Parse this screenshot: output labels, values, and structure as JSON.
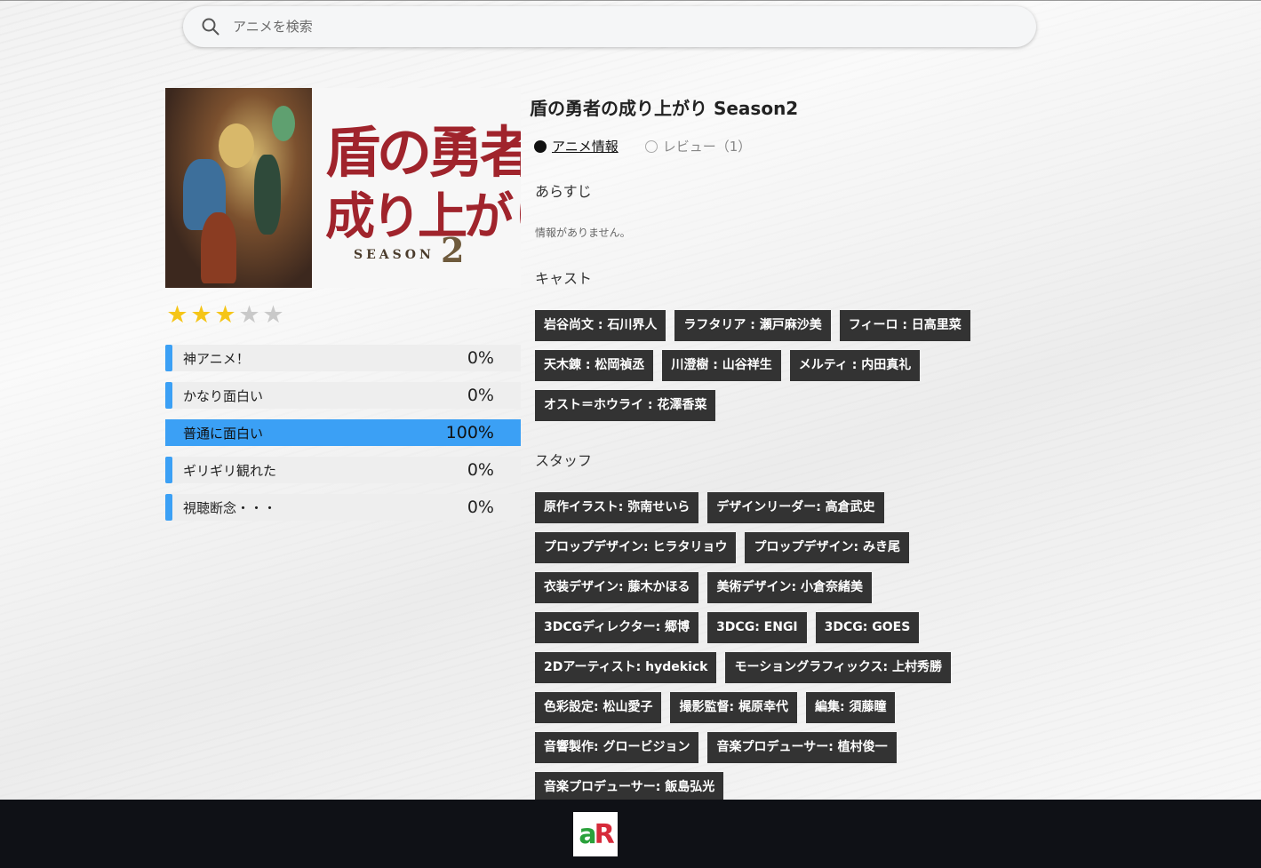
{
  "search": {
    "placeholder": "アニメを検索"
  },
  "anime": {
    "title": "盾の勇者の成り上がり Season2",
    "poster": {
      "logo_line1": "盾の勇者の",
      "logo_line2": "成り上がり",
      "season_word": "SEASON",
      "season_number": "2"
    },
    "stars": {
      "rating": 3,
      "max": 5
    }
  },
  "ratings": [
    {
      "label": "神アニメ！",
      "pct_text": "0%",
      "value": 0
    },
    {
      "label": "かなり面白い",
      "pct_text": "0%",
      "value": 0
    },
    {
      "label": "普通に面白い",
      "pct_text": "100%",
      "value": 100
    },
    {
      "label": "ギリギリ観れた",
      "pct_text": "0%",
      "value": 0
    },
    {
      "label": "視聴断念・・・",
      "pct_text": "0%",
      "value": 0
    }
  ],
  "tabs": [
    {
      "label": "アニメ情報",
      "active": true
    },
    {
      "label": "レビュー（1）",
      "active": false
    }
  ],
  "sections": {
    "synopsis_heading": "あらすじ",
    "synopsis_text": "情報がありません。",
    "cast_heading": "キャスト",
    "staff_heading": "スタッフ"
  },
  "cast": [
    "岩谷尚文 : 石川界人",
    "ラフタリア : 瀬戸麻沙美",
    "フィーロ : 日高里菜",
    "天木錬 : 松岡禎丞",
    "川澄樹 : 山谷祥生",
    "メルティ : 内田真礼",
    "オスト＝ホウライ : 花澤香菜"
  ],
  "staff": [
    "原作イラスト: 弥南せいら",
    "デザインリーダー: 高倉武史",
    "プロップデザイン: ヒラタリョウ",
    "プロップデザイン: みき尾",
    "衣装デザイン: 藤木かほる",
    "美術デザイン: 小倉奈緒美",
    "3DCGディレクター: 郷博",
    "3DCG: ENGI",
    "3DCG: GOES",
    "2Dアーティスト: hydekick",
    "モーショングラフィックス: 上村秀勝",
    "色彩設定: 松山愛子",
    "撮影監督: 梶原幸代",
    "編集: 須藤瞳",
    "音響製作: グロービジョン",
    "音楽プロデューサー: 植村俊一",
    "音楽プロデューサー: 飯島弘光"
  ],
  "colors": {
    "accent": "#3ba0f5",
    "chip_bg": "#333333",
    "star_on": "#f5c518",
    "star_off": "#c9c9c9",
    "footer_bg": "#0f1116"
  },
  "footer": {
    "brand_a": "a",
    "brand_r": "R"
  }
}
